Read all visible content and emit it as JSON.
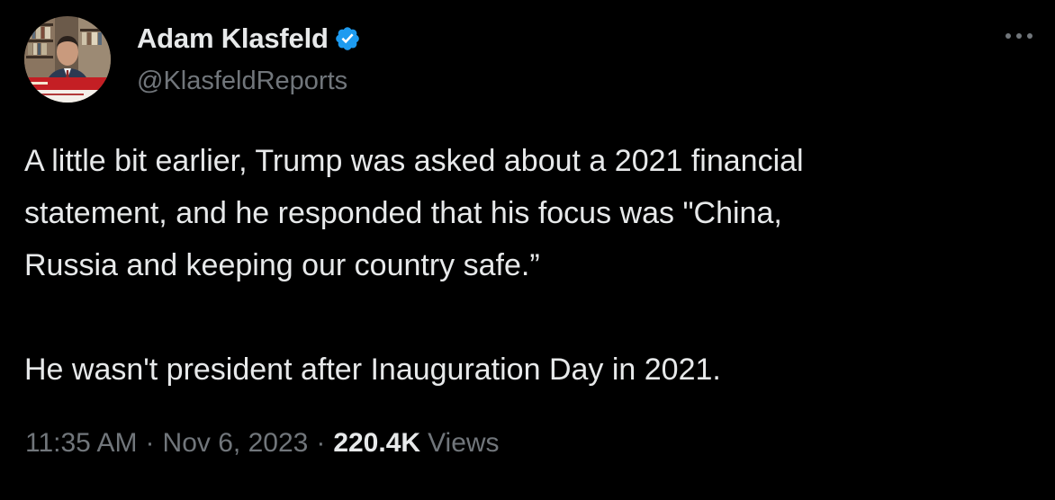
{
  "author": {
    "display_name": "Adam Klasfeld",
    "handle": "@KlasfeldReports",
    "verified_color": "#1d9bf0"
  },
  "tweet": {
    "paragraphs": [
      "A little bit earlier, Trump was asked about a 2021 financial\nstatement, and he responded that his focus was \"China,\nRussia and keeping our country safe.”",
      "He wasn't president after Inauguration Day in 2021."
    ],
    "time": "11:35 AM",
    "date": "Nov 6, 2023",
    "separator": "·",
    "views_count": "220.4K",
    "views_label": "Views"
  },
  "icons": {
    "verified": "verified-badge-icon",
    "more": "more-options-icon"
  },
  "colors": {
    "background": "#000000",
    "primary_text": "#e7e9ea",
    "secondary_text": "#71767b"
  }
}
